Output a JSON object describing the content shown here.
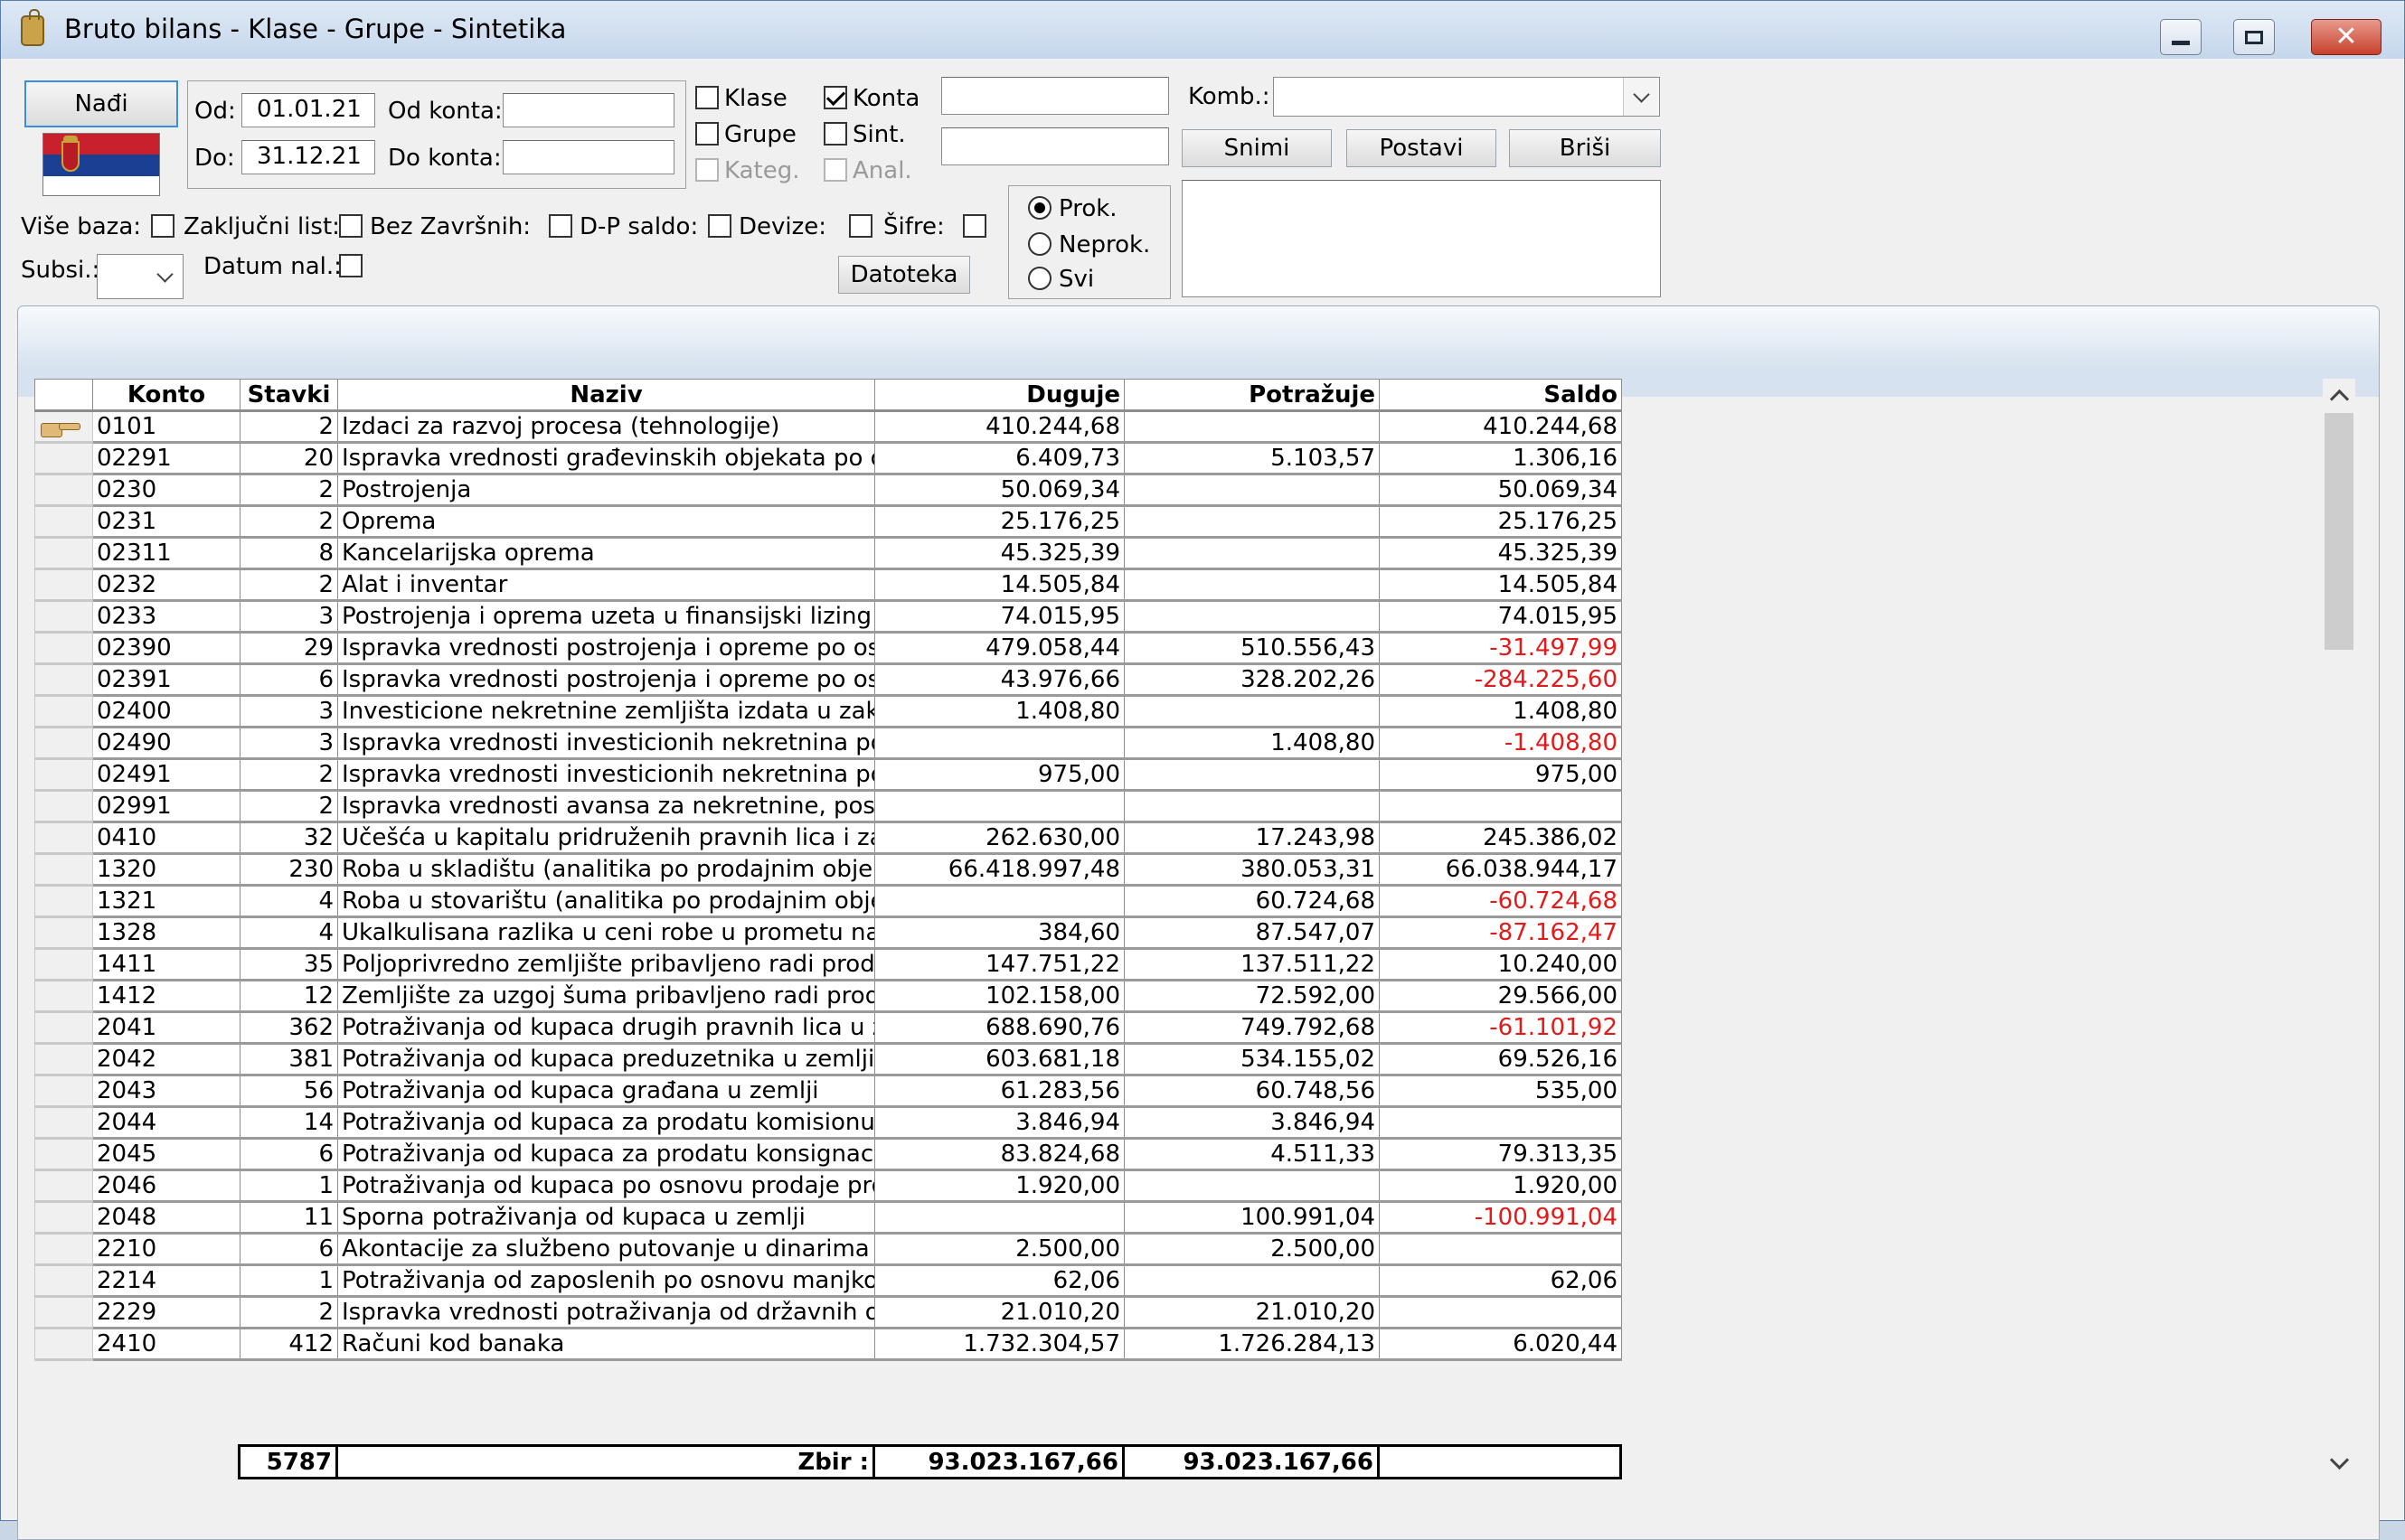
{
  "window": {
    "title": "Bruto bilans - Klase - Grupe - Sintetika"
  },
  "toolbar": {
    "find_label": "Nađi",
    "od_label": "Od:",
    "od_value": "01.01.21",
    "do_label": "Do:",
    "do_value": "31.12.21",
    "od_konta_label": "Od konta:",
    "od_konta_value": "",
    "do_konta_label": "Do konta:",
    "do_konta_value": "",
    "klase_label": "Klase",
    "grupe_label": "Grupe",
    "kateg_label": "Kateg.",
    "konta_label": "Konta",
    "sint_label": "Sint.",
    "anal_label": "Anal.",
    "text1_value": "",
    "text2_value": "",
    "komb_label": "Komb.:",
    "komb_value": "",
    "snimi_label": "Snimi",
    "postavi_label": "Postavi",
    "brisi_label": "Briši",
    "vise_baza_label": "Više baza:",
    "zakljucni_list_label": "Zaključni list:",
    "bez_zavrsnih_label": "Bez Završnih:",
    "dp_saldo_label": "D-P saldo:",
    "devize_label": "Devize:",
    "sifre_label": "Šifre:",
    "subsi_label": "Subsi.:",
    "subsi_value": "",
    "datum_nal_label": "Datum nal.:",
    "datoteka_label": "Datoteka",
    "prok_label": "Prok.",
    "neprok_label": "Neprok.",
    "svi_label": "Svi",
    "memo_value": ""
  },
  "checkboxes": {
    "klase": false,
    "grupe": false,
    "kateg": false,
    "konta": true,
    "sint": false,
    "anal": false,
    "vise_baza": false,
    "zakljucni_list": false,
    "bez_zavrsnih": false,
    "dp_saldo": false,
    "devize": false,
    "sifre": false,
    "datum_nal": false
  },
  "radio_selected": "Prok.",
  "grid": {
    "columns": [
      "Konto",
      "Stavki",
      "Naziv",
      "Duguje",
      "Potražuje",
      "Saldo"
    ],
    "rows": [
      {
        "konto": "0101",
        "stavki": "2",
        "naziv": "Izdaci za razvoj procesa (tehnologije)",
        "duguje": "410.244,68",
        "potrazuje": "",
        "saldo": "410.244,68",
        "neg": false,
        "current": true
      },
      {
        "konto": "02291",
        "stavki": "20",
        "naziv": "Ispravka vrednosti građevinskih objekata po osnc",
        "duguje": "6.409,73",
        "potrazuje": "5.103,57",
        "saldo": "1.306,16",
        "neg": false
      },
      {
        "konto": "0230",
        "stavki": "2",
        "naziv": "Postrojenja",
        "duguje": "50.069,34",
        "potrazuje": "",
        "saldo": "50.069,34",
        "neg": false
      },
      {
        "konto": "0231",
        "stavki": "2",
        "naziv": "Oprema",
        "duguje": "25.176,25",
        "potrazuje": "",
        "saldo": "25.176,25",
        "neg": false
      },
      {
        "konto": "02311",
        "stavki": "8",
        "naziv": "Kancelarijska oprema",
        "duguje": "45.325,39",
        "potrazuje": "",
        "saldo": "45.325,39",
        "neg": false
      },
      {
        "konto": "0232",
        "stavki": "2",
        "naziv": "Alat i inventar",
        "duguje": "14.505,84",
        "potrazuje": "",
        "saldo": "14.505,84",
        "neg": false
      },
      {
        "konto": "0233",
        "stavki": "3",
        "naziv": "Postrojenja i oprema uzeta u finansijski lizing",
        "duguje": "74.015,95",
        "potrazuje": "",
        "saldo": "74.015,95",
        "neg": false
      },
      {
        "konto": "02390",
        "stavki": "29",
        "naziv": "Ispravka vrednosti postrojenja i opreme po osnov",
        "duguje": "479.058,44",
        "potrazuje": "510.556,43",
        "saldo": "-31.497,99",
        "neg": true
      },
      {
        "konto": "02391",
        "stavki": "6",
        "naziv": "Ispravka vrednosti postrojenja i opreme po osnov",
        "duguje": "43.976,66",
        "potrazuje": "328.202,26",
        "saldo": "-284.225,60",
        "neg": true
      },
      {
        "konto": "02400",
        "stavki": "3",
        "naziv": "Investicione nekretnine zemljišta izdata u zakup",
        "duguje": "1.408,80",
        "potrazuje": "",
        "saldo": "1.408,80",
        "neg": false
      },
      {
        "konto": "02490",
        "stavki": "3",
        "naziv": "Ispravka vrednosti investicionih nekretnina po os",
        "duguje": "",
        "potrazuje": "1.408,80",
        "saldo": "-1.408,80",
        "neg": true
      },
      {
        "konto": "02491",
        "stavki": "2",
        "naziv": "Ispravka vrednosti investicionih nekretnina po os",
        "duguje": "975,00",
        "potrazuje": "",
        "saldo": "975,00",
        "neg": false
      },
      {
        "konto": "02991",
        "stavki": "2",
        "naziv": "Ispravka vrednosti avansa za nekretnine, postro",
        "duguje": "",
        "potrazuje": "",
        "saldo": "",
        "neg": false
      },
      {
        "konto": "0410",
        "stavki": "32",
        "naziv": "Učešća u kapitalu pridruženih pravnih lica i zajedn",
        "duguje": "262.630,00",
        "potrazuje": "17.243,98",
        "saldo": "245.386,02",
        "neg": false
      },
      {
        "konto": "1320",
        "stavki": "230",
        "naziv": "Roba u skladištu (analitika po prodajnim objektima",
        "duguje": "66.418.997,48",
        "potrazuje": "380.053,31",
        "saldo": "66.038.944,17",
        "neg": false
      },
      {
        "konto": "1321",
        "stavki": "4",
        "naziv": "Roba u stovarištu (analitika po prodajnim objektin",
        "duguje": "",
        "potrazuje": "60.724,68",
        "saldo": "-60.724,68",
        "neg": true
      },
      {
        "konto": "1328",
        "stavki": "4",
        "naziv": "Ukalkulisana razlika u ceni robe u prometu na velil",
        "duguje": "384,60",
        "potrazuje": "87.547,07",
        "saldo": "-87.162,47",
        "neg": true
      },
      {
        "konto": "1411",
        "stavki": "35",
        "naziv": "Poljoprivredno zemljište pribavljeno radi prodaje",
        "duguje": "147.751,22",
        "potrazuje": "137.511,22",
        "saldo": "10.240,00",
        "neg": false
      },
      {
        "konto": "1412",
        "stavki": "12",
        "naziv": "Zemljište za uzgoj šuma pribavljeno radi prodaje",
        "duguje": "102.158,00",
        "potrazuje": "72.592,00",
        "saldo": "29.566,00",
        "neg": false
      },
      {
        "konto": "2041",
        "stavki": "362",
        "naziv": "Potraživanja od kupaca drugih pravnih lica u zeml",
        "duguje": "688.690,76",
        "potrazuje": "749.792,68",
        "saldo": "-61.101,92",
        "neg": true
      },
      {
        "konto": "2042",
        "stavki": "381",
        "naziv": "Potraživanja od kupaca preduzetnika u zemlji",
        "duguje": "603.681,18",
        "potrazuje": "534.155,02",
        "saldo": "69.526,16",
        "neg": false
      },
      {
        "konto": "2043",
        "stavki": "56",
        "naziv": "Potraživanja od kupaca građana u zemlji",
        "duguje": "61.283,56",
        "potrazuje": "60.748,56",
        "saldo": "535,00",
        "neg": false
      },
      {
        "konto": "2044",
        "stavki": "14",
        "naziv": "Potraživanja od kupaca za prodatu komisionu rob",
        "duguje": "3.846,94",
        "potrazuje": "3.846,94",
        "saldo": "",
        "neg": false
      },
      {
        "konto": "2045",
        "stavki": "6",
        "naziv": "Potraživanja od kupaca za prodatu konsignacionu",
        "duguje": "83.824,68",
        "potrazuje": "4.511,33",
        "saldo": "79.313,35",
        "neg": false
      },
      {
        "konto": "2046",
        "stavki": "1",
        "naziv": "Potraživanja od kupaca po osnovu prodaje proizv",
        "duguje": "1.920,00",
        "potrazuje": "",
        "saldo": "1.920,00",
        "neg": false
      },
      {
        "konto": "2048",
        "stavki": "11",
        "naziv": "Sporna potraživanja od kupaca u zemlji",
        "duguje": "",
        "potrazuje": "100.991,04",
        "saldo": "-100.991,04",
        "neg": true
      },
      {
        "konto": "2210",
        "stavki": "6",
        "naziv": "Akontacije za službeno putovanje u dinarima",
        "duguje": "2.500,00",
        "potrazuje": "2.500,00",
        "saldo": "",
        "neg": false
      },
      {
        "konto": "2214",
        "stavki": "1",
        "naziv": "Potraživanja od zaposlenih po osnovu manjkova",
        "duguje": "62,06",
        "potrazuje": "",
        "saldo": "62,06",
        "neg": false
      },
      {
        "konto": "2229",
        "stavki": "2",
        "naziv": "Ispravka vrednosti potraživanja od državnih orga",
        "duguje": "21.010,20",
        "potrazuje": "21.010,20",
        "saldo": "",
        "neg": false
      },
      {
        "konto": "2410",
        "stavki": "412",
        "naziv": "Računi kod banaka",
        "duguje": "1.732.304,57",
        "potrazuje": "1.726.284,13",
        "saldo": "6.020,44",
        "neg": false
      }
    ],
    "totals": {
      "stavki": "5787",
      "label": "Zbir :",
      "duguje": "93.023.167,66",
      "potrazuje": "93.023.167,66",
      "saldo": ""
    }
  },
  "colors": {
    "negative": "#e21a1a",
    "focus_border": "#3a8edb"
  },
  "icons": [
    "app-icon",
    "minimize-icon",
    "maximize-icon",
    "close-icon",
    "serbian-flag-icon",
    "row-pointer-icon",
    "chevron-down-icon",
    "scroll-up-icon",
    "scroll-down-icon"
  ]
}
